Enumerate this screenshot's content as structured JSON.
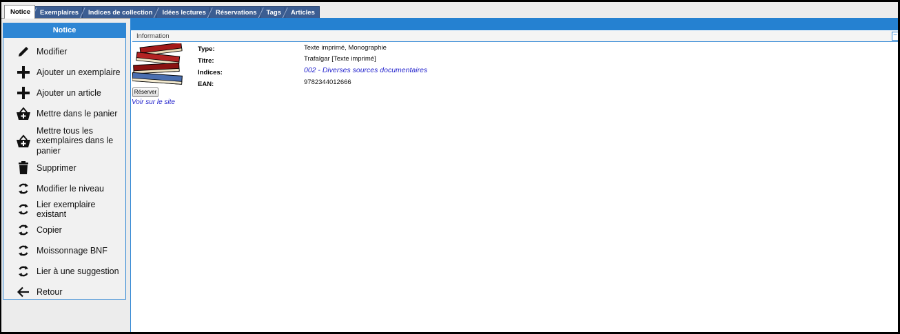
{
  "tabs": [
    {
      "label": "Notice",
      "active": true
    },
    {
      "label": "Exemplaires",
      "active": false
    },
    {
      "label": "Indices de collection",
      "active": false
    },
    {
      "label": "Idées lectures",
      "active": false
    },
    {
      "label": "Réservations",
      "active": false
    },
    {
      "label": "Tags",
      "active": false
    },
    {
      "label": "Articles",
      "active": false
    }
  ],
  "sidebar": {
    "title": "Notice",
    "items": [
      {
        "label": "Modifier",
        "icon": "pencil-icon"
      },
      {
        "label": "Ajouter un exemplaire",
        "icon": "plus-icon"
      },
      {
        "label": "Ajouter un article",
        "icon": "plus-icon"
      },
      {
        "label": "Mettre dans le panier",
        "icon": "basket-icon"
      },
      {
        "label": "Mettre tous les exemplaires dans le panier",
        "icon": "basket-icon"
      },
      {
        "label": "Supprimer",
        "icon": "trash-icon"
      },
      {
        "label": "Modifier le niveau",
        "icon": "refresh-icon"
      },
      {
        "label": "Lier exemplaire existant",
        "icon": "refresh-icon"
      },
      {
        "label": "Copier",
        "icon": "refresh-icon"
      },
      {
        "label": "Moissonnage BNF",
        "icon": "refresh-icon"
      },
      {
        "label": "Lier à une suggestion",
        "icon": "refresh-icon"
      },
      {
        "label": "Retour",
        "icon": "arrow-left-icon"
      }
    ]
  },
  "info": {
    "section_title": "Information",
    "collapse_symbol": "−",
    "reserve_label": "Réserver",
    "site_link": "Voir sur le site",
    "fields": [
      {
        "label": "Type:",
        "value": "Texte imprimé, Monographie",
        "link": false
      },
      {
        "label": "Titre:",
        "value": "Trafalgar [Texte imprimé]",
        "link": false
      },
      {
        "label": "Indices:",
        "value": "002 - Diverses sources documentaires",
        "link": true
      },
      {
        "label": "EAN:",
        "value": "9782344012666",
        "link": false
      }
    ]
  },
  "colors": {
    "accent": "#2e86d4",
    "tab": "#3b5d92",
    "link": "#2222cc"
  }
}
